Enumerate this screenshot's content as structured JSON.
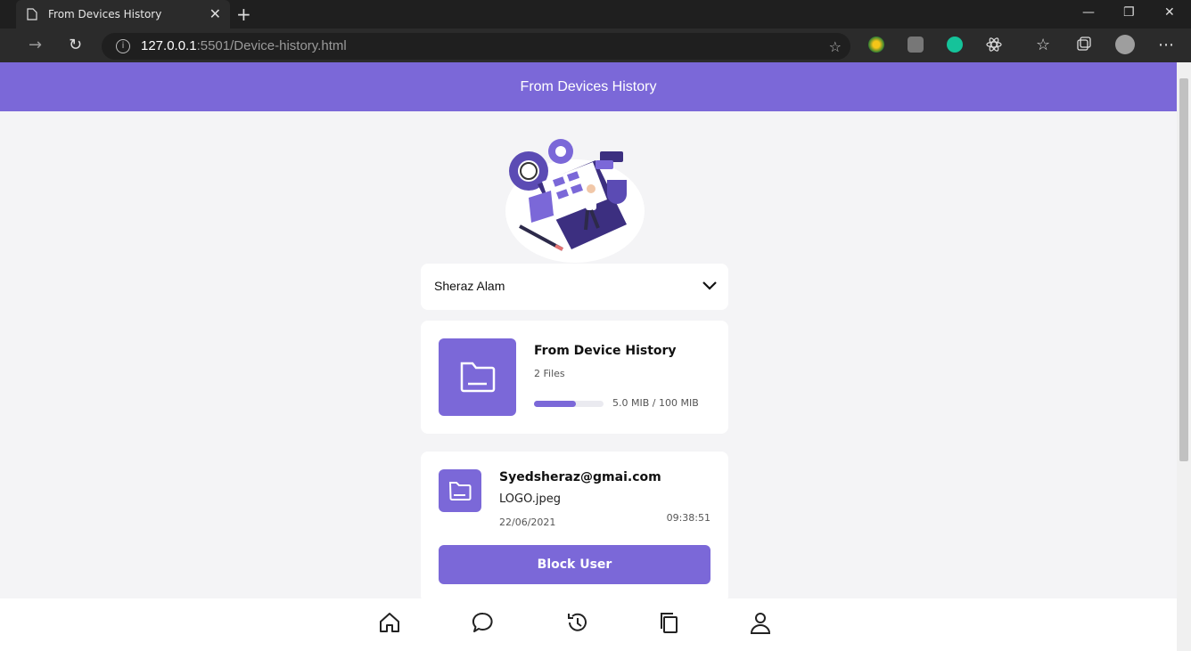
{
  "browser": {
    "tab_title": "From Devices History",
    "tab_close": "✕",
    "new_tab": "+",
    "url_host": "127.0.0.1",
    "url_rest": ":5501/Device-history.html",
    "back": "←",
    "forward": "→",
    "reload": "↻",
    "menu": "⋯",
    "win_min": "—",
    "win_restore": "❐",
    "win_close": "✕"
  },
  "page": {
    "header_title": "From Devices History",
    "user_select": {
      "selected": "Sheraz Alam"
    },
    "storage": {
      "title": "From Device History",
      "files": "2 Files",
      "usage": "5.0 MIB / 100 MIB",
      "progress": 0.6
    },
    "entry": {
      "email": "Syedsheraz@gmai.com",
      "file_name": "LOGO.jpeg",
      "date": "22/06/2021",
      "time": "09:38:51",
      "block_label": "Block User"
    }
  },
  "colors": {
    "accent": "#7b68d8",
    "background": "#f4f4f6"
  },
  "bottom_nav": [
    "home-icon",
    "chat-icon",
    "history-icon",
    "copy-icon",
    "profile-icon"
  ]
}
